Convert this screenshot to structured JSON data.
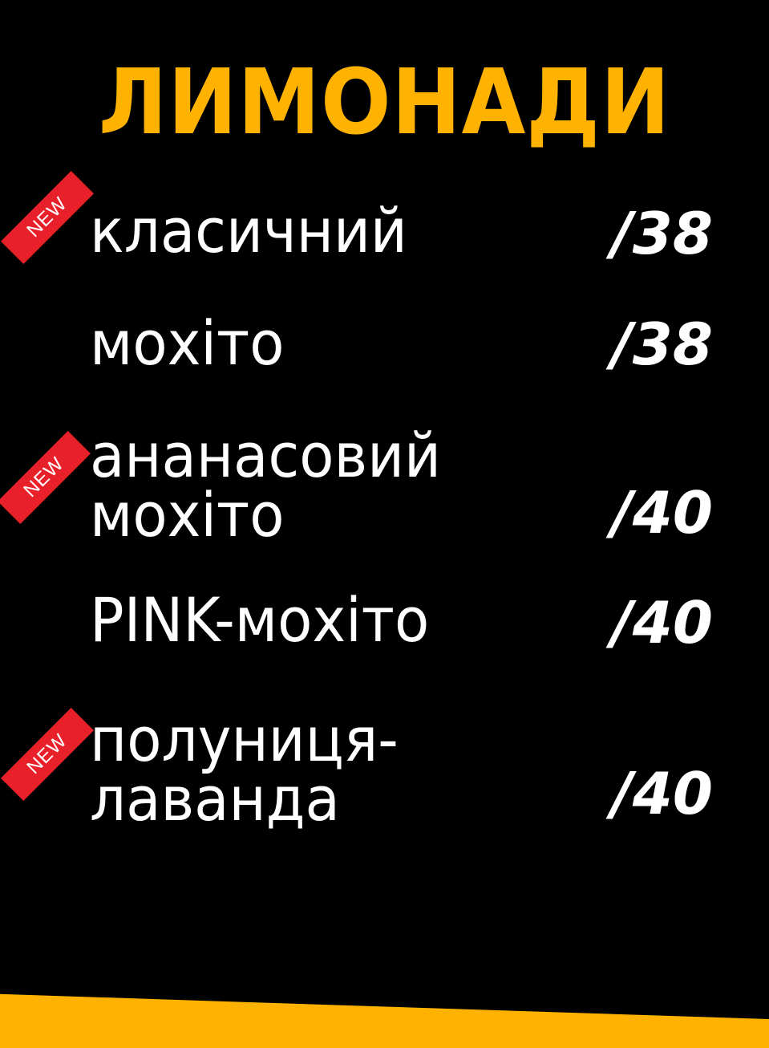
{
  "title": "ЛИМОНАДИ",
  "colors": {
    "background": "#000000",
    "accent": "#FFB300",
    "text": "#FFFFFF",
    "badge_bg": "#E8202A",
    "badge_text": "#FFFFFF"
  },
  "items": [
    {
      "line1": "класичний",
      "line2": "",
      "price": "/38",
      "badge": "NEW"
    },
    {
      "line1": "мохіто",
      "line2": "",
      "price": "/38",
      "badge": ""
    },
    {
      "line1": "ананасовий",
      "line2": "мохіто",
      "price": "/40",
      "badge": "NEW"
    },
    {
      "line1": "PINK-мохіто",
      "line2": "",
      "price": "/40",
      "badge": ""
    },
    {
      "line1": "полуниця-",
      "line2": "лаванда",
      "price": "/40",
      "badge": "NEW"
    }
  ]
}
